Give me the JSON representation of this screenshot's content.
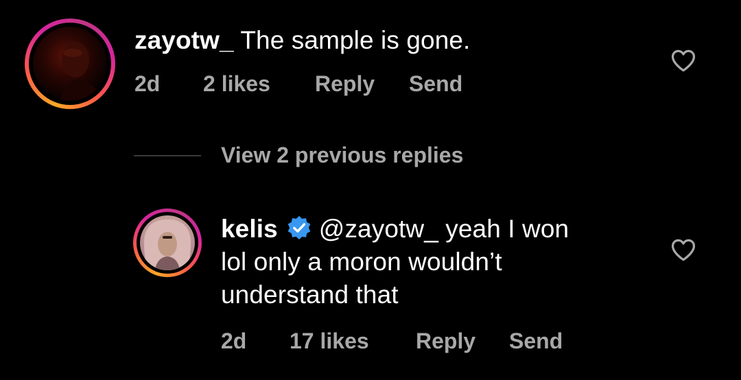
{
  "comments": [
    {
      "username": "zayotw_",
      "text": "The sample is gone.",
      "time": "2d",
      "likes": "2 likes",
      "reply_label": "Reply",
      "send_label": "Send"
    },
    {
      "username": "kelis",
      "verified": true,
      "mention": "@zayotw_",
      "text_line1": "yeah I won",
      "text_line2": "lol only a moron wouldn’t",
      "text_line3": "understand that",
      "time": "2d",
      "likes": "17 likes",
      "reply_label": "Reply",
      "send_label": "Send"
    }
  ],
  "thread": {
    "view_replies_label": "View 2 previous replies"
  },
  "icons": {
    "like": "heart-outline-icon",
    "verified": "verified-badge-icon"
  },
  "colors": {
    "background": "#000000",
    "text": "#ffffff",
    "meta": "#a8a8a8",
    "verified": "#3897f0"
  }
}
